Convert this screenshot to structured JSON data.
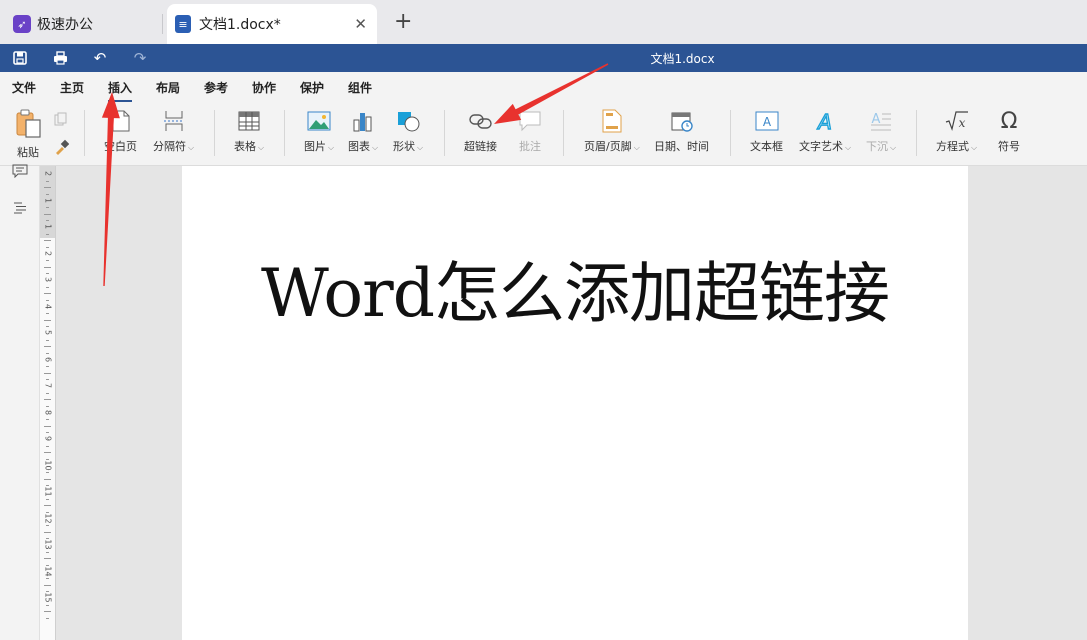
{
  "tabs": {
    "app_label": "极速办公",
    "doc_label": "文档1.docx*",
    "new_tab_symbol": "+"
  },
  "titlebar": {
    "document_title": "文档1.docx"
  },
  "menu": {
    "items": [
      "文件",
      "主页",
      "插入",
      "布局",
      "参考",
      "协作",
      "保护",
      "组件"
    ],
    "active": "插入"
  },
  "ribbon": {
    "paste": "粘贴",
    "blank_page": "空白页",
    "separator": "分隔符",
    "table": "表格",
    "picture": "图片",
    "chart": "图表",
    "shape": "形状",
    "hyperlink": "超链接",
    "comment": "批注",
    "header_footer": "页眉/页脚",
    "date_time": "日期、时间",
    "textbox": "文本框",
    "wordart": "文字艺术",
    "dropcap": "下沉",
    "equation": "方程式",
    "symbol": "符号"
  },
  "ruler": {
    "numbers": [
      "2",
      "1",
      "1",
      "2",
      "3",
      "4",
      "5",
      "6",
      "7",
      "8",
      "9",
      "10",
      "11",
      "12",
      "13",
      "14",
      "15"
    ]
  },
  "document": {
    "heading": "Word怎么添加超链接"
  },
  "colors": {
    "titlebar": "#2c5494",
    "arrow": "#e8322e",
    "app_icon": "#6a42c7"
  }
}
